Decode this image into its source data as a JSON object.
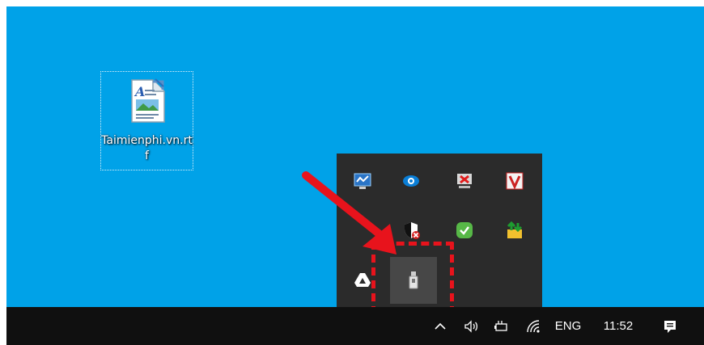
{
  "desktop": {
    "file_icon": {
      "label": "Taimienphi.vn.rtf",
      "icon": "rtf-document-icon"
    }
  },
  "tray_overflow": {
    "icons": [
      {
        "name": "network-monitor-icon"
      },
      {
        "name": "teamviewer-icon"
      },
      {
        "name": "display-error-icon"
      },
      {
        "name": "antivirus-v-icon"
      },
      {
        "name": "security-shield-icon"
      },
      {
        "name": "green-check-icon"
      },
      {
        "name": "sync-update-icon"
      },
      {
        "name": "google-drive-icon"
      },
      {
        "name": "usb-drive-icon"
      }
    ],
    "highlight_color": "#e8131c"
  },
  "taskbar": {
    "language": "ENG",
    "time": "11:52",
    "icons": [
      "chevron-up-icon",
      "volume-icon",
      "battery-icon",
      "wifi-icon",
      "notification-icon"
    ]
  },
  "colors": {
    "desktop": "#00a2e8",
    "taskbar": "#101010",
    "tray_popup": "#2b2b2b",
    "arrow": "#e8131c"
  }
}
